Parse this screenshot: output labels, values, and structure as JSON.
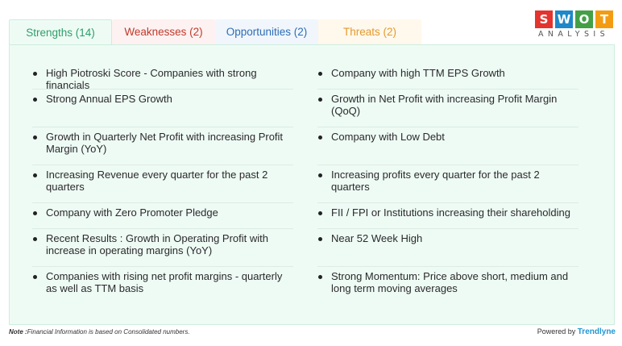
{
  "tabs": {
    "strengths": "Strengths (14)",
    "weaknesses": "Weaknesses (2)",
    "opportunities": "Opportunities (2)",
    "threats": "Threats (2)"
  },
  "colors": {
    "strengths": "#2e9e69",
    "weaknesses": "#c0392b",
    "opportunities": "#2e6db4",
    "threats": "#e39a2d"
  },
  "logo": {
    "letters": [
      "S",
      "W",
      "O",
      "T"
    ],
    "letter_colors": [
      "#e3342f",
      "#1e88c8",
      "#43a047",
      "#f39c12"
    ],
    "subtitle": "ANALYSIS"
  },
  "strengths_left": [
    "High Piotroski Score - Companies with strong financials",
    "Strong Annual EPS Growth",
    "Growth in Quarterly Net Profit with increasing Profit Margin (YoY)",
    "Increasing Revenue every quarter for the past 2 quarters",
    "Company with Zero Promoter Pledge",
    "Recent Results : Growth in Operating Profit with increase in operating margins (YoY)",
    "Companies with rising net profit margins - quarterly as well as TTM basis"
  ],
  "strengths_right": [
    "Company with high TTM EPS Growth",
    "Growth in Net Profit with increasing Profit Margin (QoQ)",
    "Company with Low Debt",
    "Increasing profits every quarter for the past 2 quarters",
    "FII / FPI or Institutions increasing their shareholding",
    "Near 52 Week High",
    "Strong Momentum: Price above short, medium and long term moving averages"
  ],
  "footer": {
    "note_label": "Note :",
    "note_text": "Financial Information is based on Consolidated numbers.",
    "powered_by": "Powered by ",
    "brand": "Trendlyne"
  }
}
